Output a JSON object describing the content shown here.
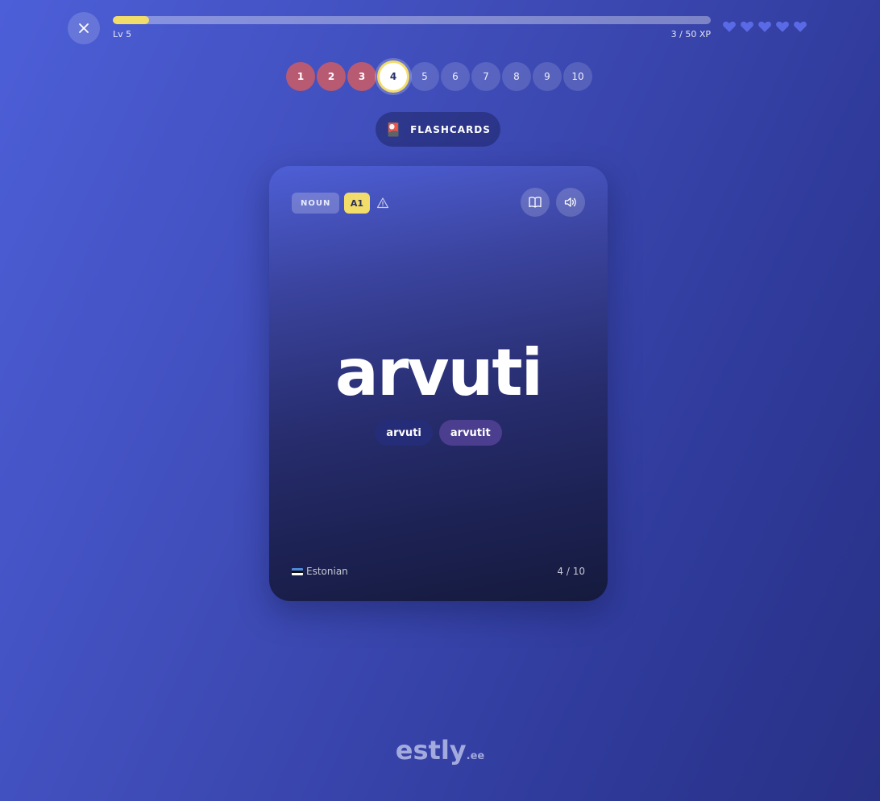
{
  "header": {
    "level_label": "Lv 5",
    "xp_label": "3 / 50 XP",
    "xp_progress": 0.06,
    "hearts_count": 5,
    "heart_color": "#5a6ae6"
  },
  "steps": [
    {
      "label": "1",
      "state": "wrong"
    },
    {
      "label": "2",
      "state": "wrong"
    },
    {
      "label": "3",
      "state": "wrong"
    },
    {
      "label": "4",
      "state": "current"
    },
    {
      "label": "5",
      "state": "pending"
    },
    {
      "label": "6",
      "state": "pending"
    },
    {
      "label": "7",
      "state": "pending"
    },
    {
      "label": "8",
      "state": "pending"
    },
    {
      "label": "9",
      "state": "pending"
    },
    {
      "label": "10",
      "state": "pending"
    }
  ],
  "mode": {
    "icon": "🎴",
    "label": "FLASHCARDS"
  },
  "card": {
    "part_of_speech": "NOUN",
    "level": "A1",
    "word": "arvuti",
    "forms": [
      "arvuti",
      "arvutit"
    ],
    "language": "Estonian",
    "counter": "4 / 10"
  },
  "logo": {
    "name": "estly",
    "tld": ".ee"
  },
  "colors": {
    "accent_yellow": "#f2dc6a",
    "wrong_step": "#b85a72"
  }
}
